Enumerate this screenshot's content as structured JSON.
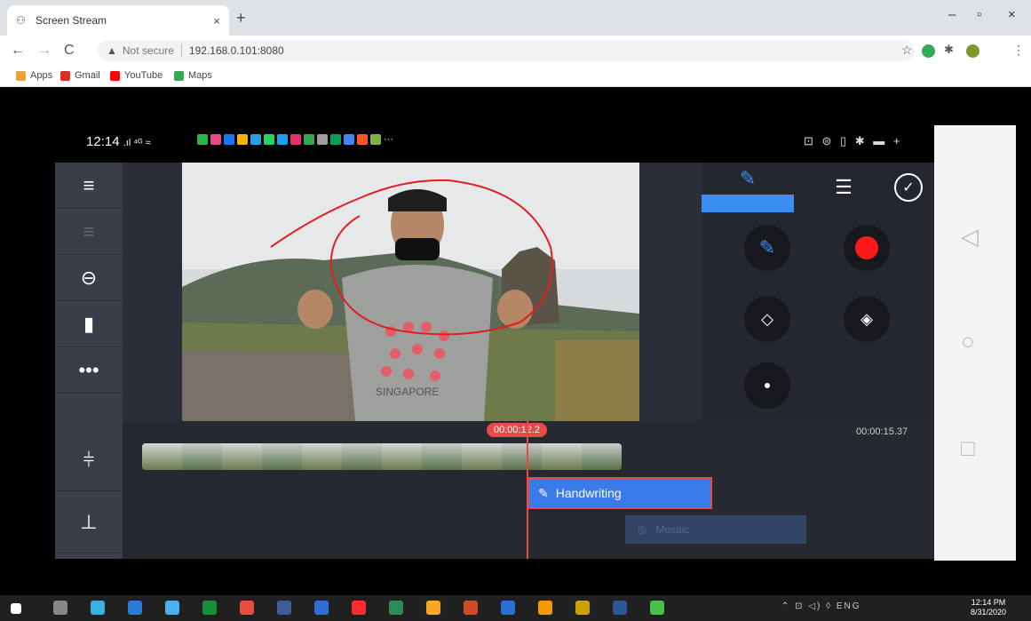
{
  "browser": {
    "tab_title": "Screen Stream",
    "tab_close": "×",
    "new_tab": "+",
    "not_secure": "Not secure",
    "url": "192.168.0.101:8080",
    "bookmarks": [
      {
        "label": "Apps",
        "color": "#e8a33c"
      },
      {
        "label": "Gmail",
        "color": "#d93025"
      },
      {
        "label": "YouTube",
        "color": "#ff0000"
      },
      {
        "label": "Maps",
        "color": "#34a853"
      }
    ]
  },
  "phone": {
    "time": "12:14",
    "status_icons": ".ıl ⁴ᴳ ≈",
    "status_right": "⊡ ⊜ ▯ ✱ ▬ +",
    "notif_colors": [
      "#2cb34a",
      "#e54a8a",
      "#1877f2",
      "#f4b400",
      "#2aa1de",
      "#25d366",
      "#1da1f2",
      "#e1306c",
      "#34a853",
      "#9e9e9e",
      "#0f9d58",
      "#4285f4",
      "#ff5722",
      "#7cb342"
    ],
    "notif_more": "···"
  },
  "editor": {
    "timecode_current": "00:00:12.2",
    "timecode_total": "00:00:15.37",
    "handwriting_label": "Handwriting",
    "mosaic_label": "Mosaic",
    "shirt_text": "SINGAPORE"
  },
  "taskbar": {
    "tray_lang": "ENG",
    "clock_time": "12:14 PM",
    "clock_date": "8/31/2020"
  },
  "colors": {
    "accent_blue": "#3a7bea",
    "playhead_red": "#e84a4a",
    "app_bg": "#2b2e38"
  }
}
